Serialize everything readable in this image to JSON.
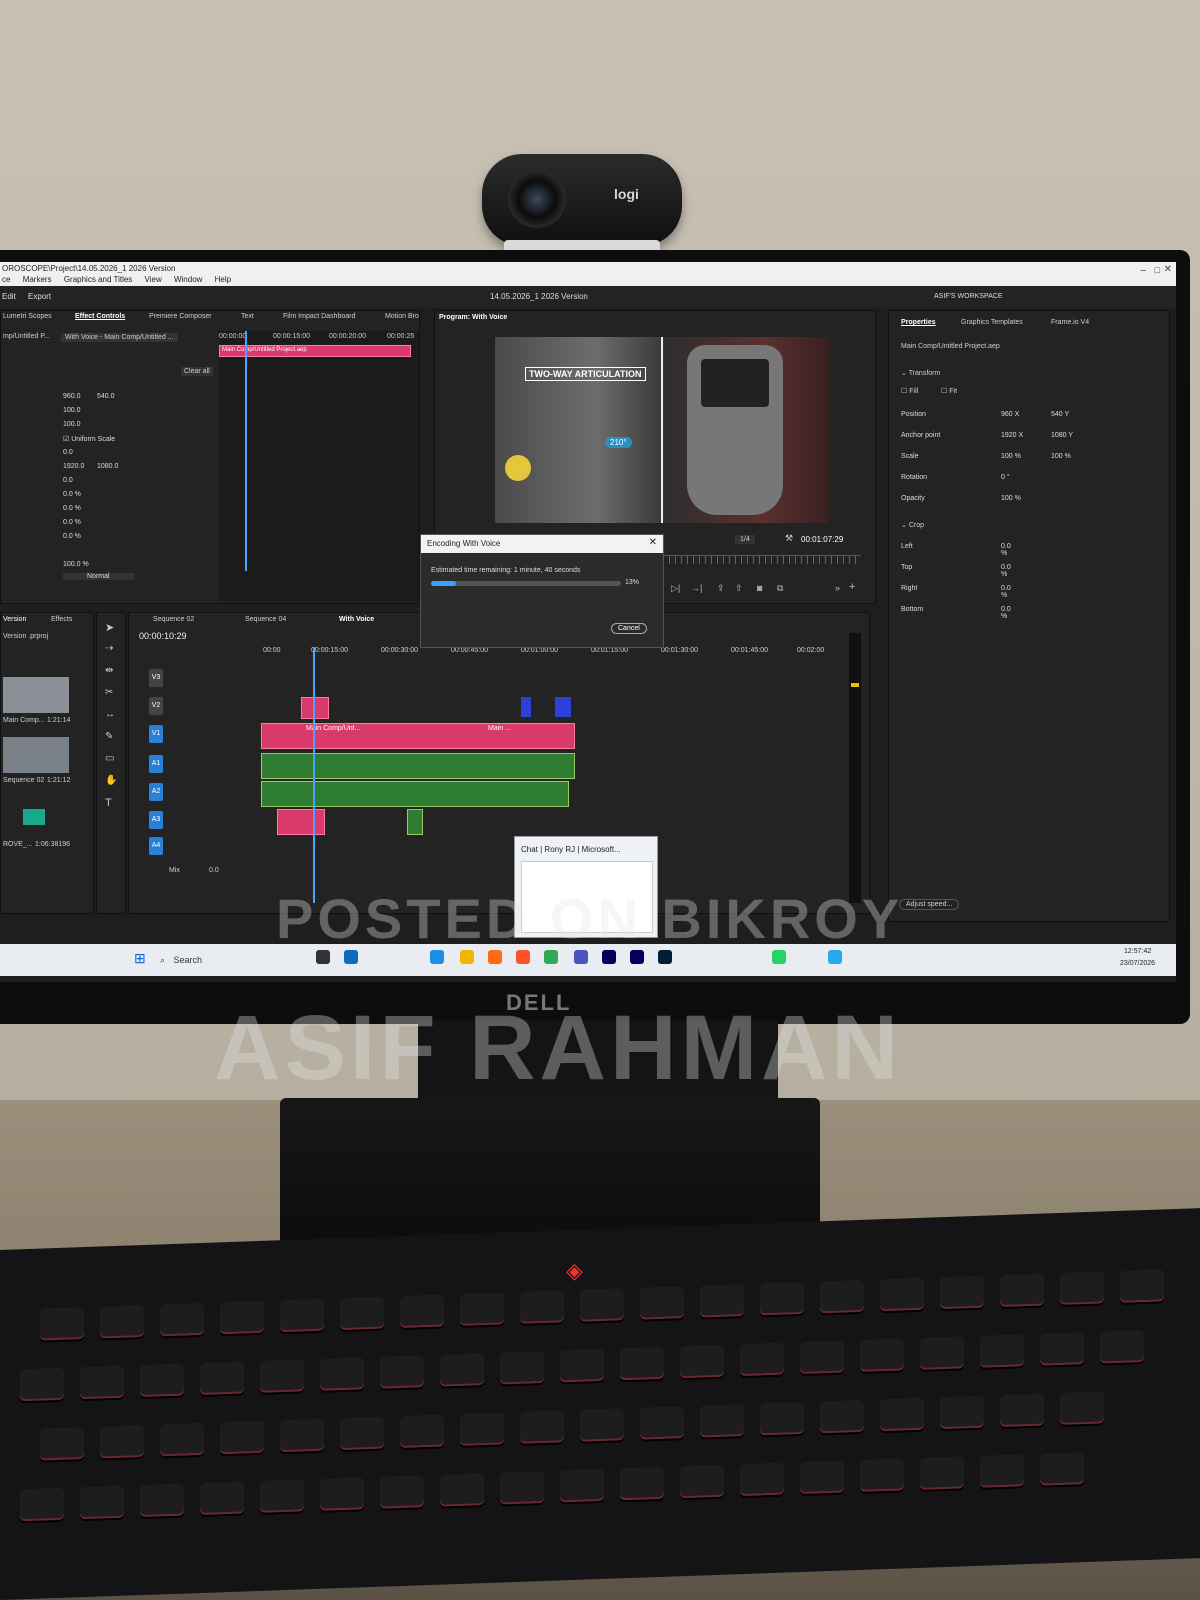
{
  "window": {
    "path": "OROSCOPE\\Project\\14.05.2026_1 2026 Version",
    "menus": [
      "ce",
      "Markers",
      "Graphics and Titles",
      "View",
      "Window",
      "Help"
    ],
    "tabs": [
      "Edit",
      "Export"
    ],
    "project_title": "14.05.2026_1 2026 Version",
    "workspace": "ASIF'S WORKSPACE"
  },
  "effect_controls": {
    "tabs": [
      "Lumetri Scopes",
      "Effect Controls",
      "Premiere Composer",
      "Text",
      "Film Impact Dashboard",
      "Motion Bro"
    ],
    "source": "mp/Untitled P...",
    "sequence": "With Voice - Main Comp/Untitled ...",
    "timecode_start": "00:00:00",
    "timecode_1": "00:00:15:00",
    "timecode_2": "00:00:20:00",
    "timecode_3": "00:00:25",
    "clip_label": "Main Comp/Untitled Project.aep",
    "clear_all": "Clear all",
    "values": [
      "960.0",
      "540.0",
      "100.0",
      "100.0",
      "Uniform Scale",
      "0.0",
      "1920.0",
      "1080.0",
      "0.0",
      "0.0 %",
      "0.0 %",
      "0.0 %",
      "0.0 %",
      "100.0 %",
      "Normal"
    ]
  },
  "program": {
    "title": "Program: With Voice",
    "overlay_text": "TWO-WAY ARTICULATION",
    "badge": "210°",
    "zoom": "1/4",
    "timecode": "00:01:07:29"
  },
  "properties": {
    "tabs": [
      "Properties",
      "Graphics Templates",
      "Frame.io V4"
    ],
    "item": "Main Comp/Untitled Project.aep",
    "transform_label": "Transform",
    "fill_label": "Fill",
    "fit_label": "Fit",
    "rows": [
      {
        "label": "Position",
        "v1": "960 X",
        "v2": "540 Y"
      },
      {
        "label": "Anchor point",
        "v1": "1920 X",
        "v2": "1080 Y"
      },
      {
        "label": "Scale",
        "v1": "100 %",
        "v2": "100 %"
      },
      {
        "label": "Rotation",
        "v1": "0 °",
        "v2": ""
      },
      {
        "label": "Opacity",
        "v1": "100 %",
        "v2": ""
      }
    ],
    "crop_label": "Crop",
    "crop_rows": [
      {
        "label": "Left",
        "v1": "0.0 %"
      },
      {
        "label": "Top",
        "v1": "0.0 %"
      },
      {
        "label": "Right",
        "v1": "0.0 %"
      },
      {
        "label": "Bottom",
        "v1": "0.0 %"
      }
    ],
    "adjust_speed": "Adjust speed..."
  },
  "project_panel": {
    "tabs": [
      "Version",
      "Effects"
    ],
    "file": "Version .prproj",
    "items": [
      {
        "name": "Main Comp...",
        "duration": "1:21:14"
      },
      {
        "name": "Sequence 02",
        "duration": "1:21:12"
      },
      {
        "name": "ROVE_...",
        "duration": "1:06:38196"
      }
    ]
  },
  "timeline": {
    "tabs": [
      "Sequence 02",
      "Sequence 04",
      "With Voice"
    ],
    "timecode": "00:00:10:29",
    "ruler": [
      "00:00",
      "00:00:15:00",
      "00:00:30:00",
      "00:00:45:00",
      "00:01:00:00",
      "00:01:15:00",
      "00:01:30:00",
      "00:01:45:00",
      "00:02:00"
    ],
    "tracks": [
      "V3",
      "V2",
      "V1",
      "A1",
      "A2",
      "A3",
      "A4",
      "Mix"
    ],
    "mix_value": "0.0",
    "clip_labels": [
      "Main Comp/Unt...",
      "Main ..."
    ]
  },
  "encoding_dialog": {
    "title": "Encoding With Voice",
    "message": "Estimated time remaining: 1 minute, 40 seconds",
    "percent": "13%",
    "progress": 0.13,
    "cancel": "Cancel"
  },
  "popup": {
    "title": "Chat | Rony RJ | Microsoft..."
  },
  "taskbar": {
    "search": "Search",
    "time": "12:57:42",
    "date": "23/07/2026"
  },
  "watermarks": {
    "top": "POSTED ON BIKROY",
    "bottom": "ASIF RAHMAN"
  },
  "hardware": {
    "webcam_brand": "logi",
    "monitor_brand": "DELL"
  }
}
